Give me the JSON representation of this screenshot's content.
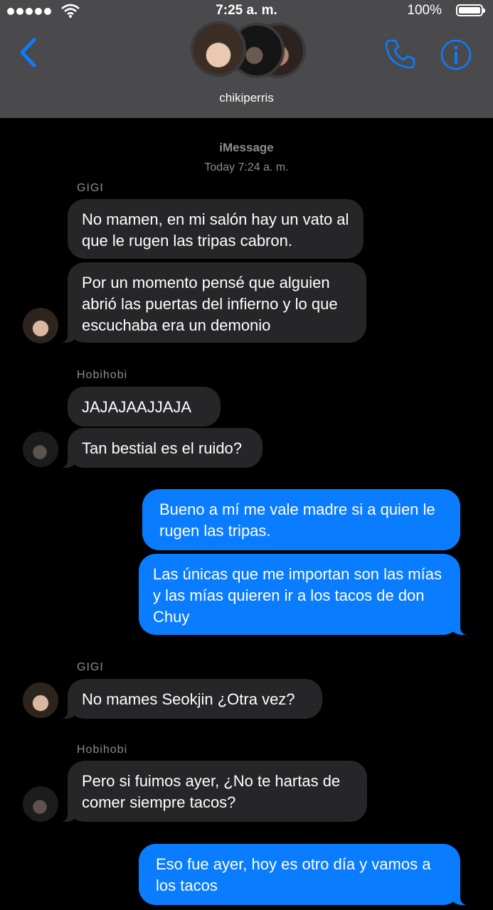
{
  "status_bar": {
    "time": "7:25 a. m.",
    "battery": "100%"
  },
  "header": {
    "group_name": "chikiperris"
  },
  "thread": {
    "service": "iMessage",
    "timestamp": "Today 7:24 a. m."
  },
  "messages": [
    {
      "sender": "GIGI",
      "text": "No mamen, en mi salón hay un vato al que le rugen las tripas cabron."
    },
    {
      "text": "Por un momento pensé que alguien abrió las puertas del infierno y lo que escuchaba era un demonio"
    },
    {
      "sender": "Hobihobi",
      "text": "JAJAJAAJJAJA"
    },
    {
      "text": "Tan bestial es el ruido?"
    },
    {
      "text": "Bueno a mí me vale madre si a quien le rugen las tripas."
    },
    {
      "text": "Las únicas que me importan son las mías y las mías quieren ir a los tacos de don Chuy"
    },
    {
      "sender": "GIGI",
      "text": "No mames Seokjin ¿Otra vez?"
    },
    {
      "sender": "Hobihobi",
      "text": "Pero si fuimos ayer, ¿No te hartas de comer siempre tacos?"
    },
    {
      "text": "Eso fue ayer, hoy es otro día y vamos a los tacos"
    }
  ],
  "colors": {
    "outgoing": "#0a7cff",
    "incoming": "#262628",
    "accent": "#0a7cff",
    "header": "#4a4a4c"
  },
  "icons": [
    "signal-icon",
    "wifi-icon",
    "battery-icon",
    "back-chevron-icon",
    "phone-icon",
    "info-icon"
  ]
}
